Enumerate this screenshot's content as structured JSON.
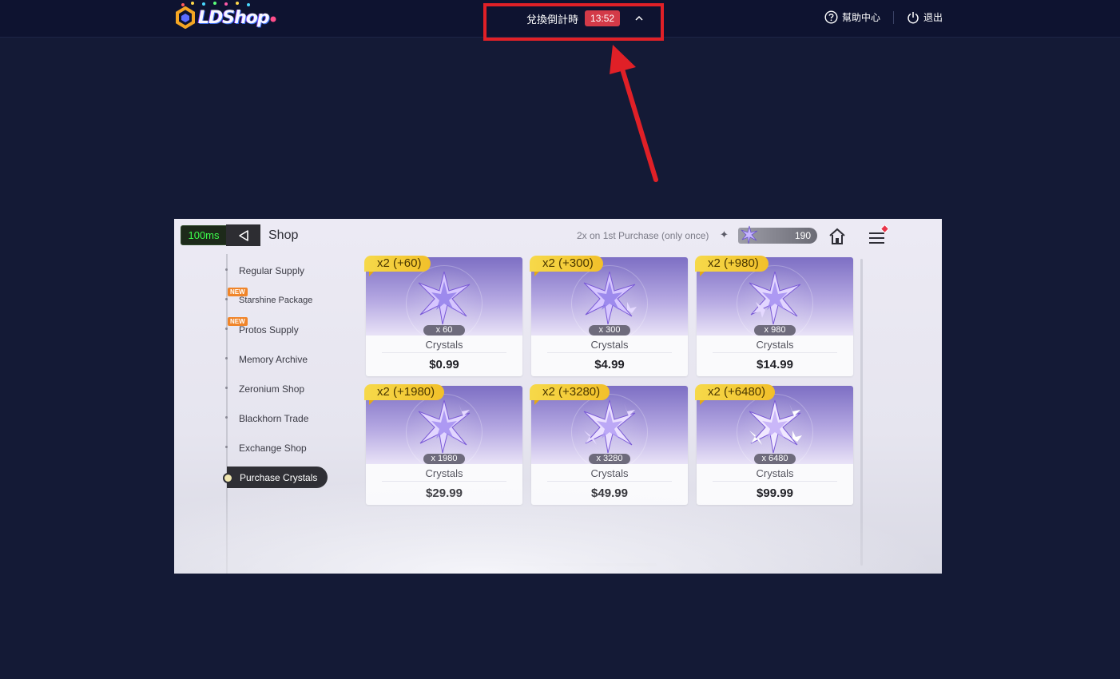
{
  "topbar": {
    "logo_text": "LDShop",
    "timer_label": "兌換倒計時",
    "timer_value": "13:52",
    "help_label": "幫助中心",
    "logout_label": "退出"
  },
  "game": {
    "ping": "100ms",
    "title": "Shop",
    "promo_text": "2x on 1st Purchase (only once)",
    "currency_value": "190",
    "nav": [
      {
        "label": "Regular Supply",
        "badge": ""
      },
      {
        "label": "Starshine Package",
        "badge": "NEW"
      },
      {
        "label": "Protos Supply",
        "badge": "NEW"
      },
      {
        "label": "Memory Archive",
        "badge": ""
      },
      {
        "label": "Zeronium Shop",
        "badge": ""
      },
      {
        "label": "Blackhorn Trade",
        "badge": ""
      },
      {
        "label": "Exchange Shop",
        "badge": ""
      },
      {
        "label": "Purchase Crystals",
        "badge": ""
      }
    ],
    "cards": [
      {
        "bonus": "x2 (+60)",
        "qty": "x 60",
        "name": "Crystals",
        "price": "$0.99"
      },
      {
        "bonus": "x2 (+300)",
        "qty": "x 300",
        "name": "Crystals",
        "price": "$4.99"
      },
      {
        "bonus": "x2 (+980)",
        "qty": "x 980",
        "name": "Crystals",
        "price": "$14.99"
      },
      {
        "bonus": "x2 (+1980)",
        "qty": "x 1980",
        "name": "Crystals",
        "price": "$29.99"
      },
      {
        "bonus": "x2 (+3280)",
        "qty": "x 3280",
        "name": "Crystals",
        "price": "$49.99"
      },
      {
        "bonus": "x2 (+6480)",
        "qty": "x 6480",
        "name": "Crystals",
        "price": "$99.99"
      }
    ]
  },
  "colors": {
    "page_bg": "#141a36",
    "highlight_red": "#e02027",
    "timer_badge": "#d33a48",
    "bonus_yellow": "#f6d94a",
    "ping_green": "#3cff4c"
  }
}
